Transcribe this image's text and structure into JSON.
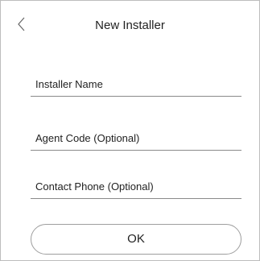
{
  "header": {
    "title": "New Installer",
    "back_icon": "chevron-left-icon"
  },
  "form": {
    "fields": [
      {
        "label": "Installer Name",
        "value": ""
      },
      {
        "label": "Agent Code (Optional)",
        "value": ""
      },
      {
        "label": "Contact Phone (Optional)",
        "value": ""
      }
    ]
  },
  "actions": {
    "ok_label": "OK"
  },
  "colors": {
    "background": "#ffffff",
    "text": "#222222",
    "underline": "#8a8a8a",
    "button_border": "#9e9e9e"
  }
}
